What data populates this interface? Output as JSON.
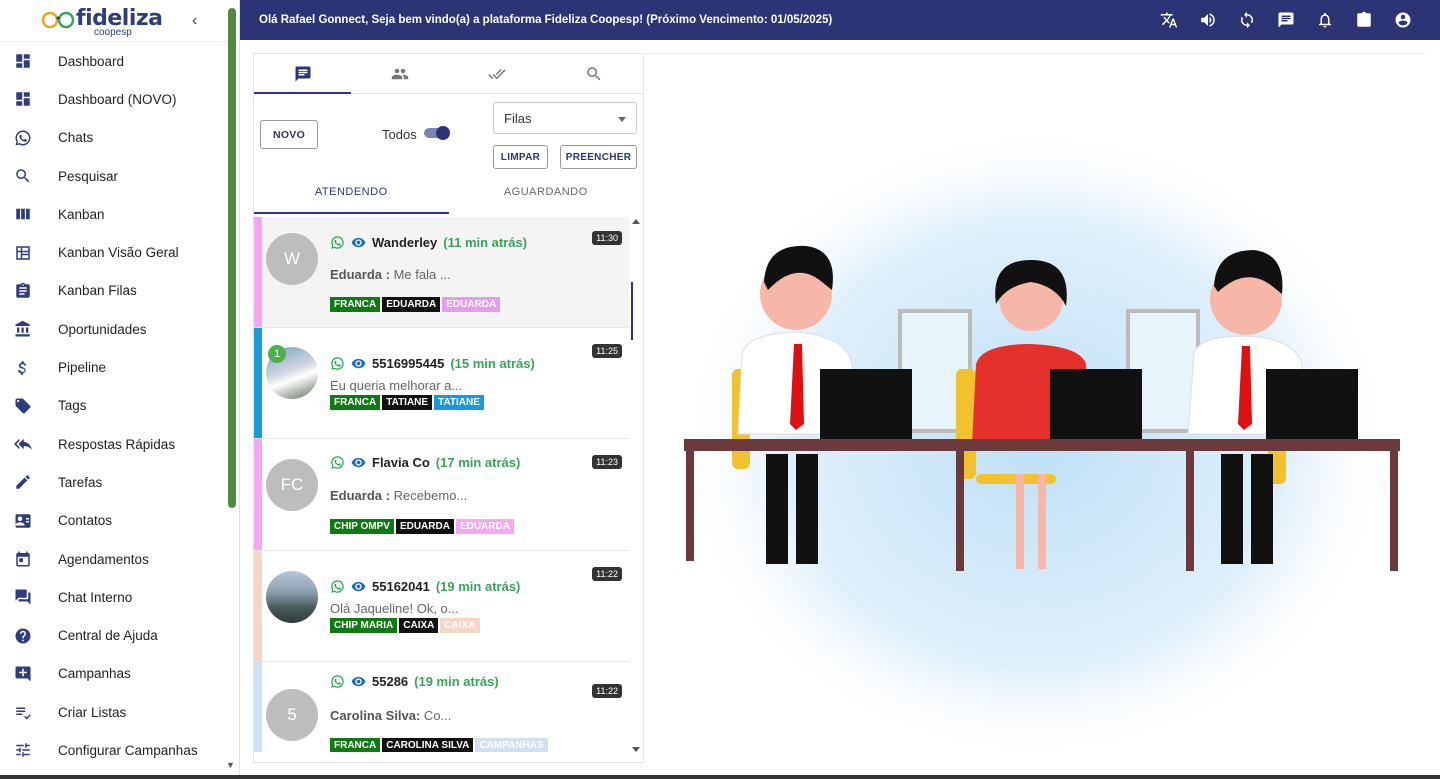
{
  "brand": {
    "name": "fideliza",
    "sub": "coopesp"
  },
  "topbar": {
    "welcome": "Olá Rafael Gonnect, Seja bem vindo(a) a plataforma Fideliza Coopesp! (Próximo Vencimento: 01/05/2025)",
    "icons": [
      "translate-icon",
      "volume-icon",
      "sync-icon",
      "message-icon",
      "notification-icon",
      "clipboard-icon",
      "account-icon"
    ]
  },
  "sidebar": {
    "items": [
      {
        "label": "Dashboard",
        "icon": "dashboard-icon"
      },
      {
        "label": "Dashboard (NOVO)",
        "icon": "dashboard-icon"
      },
      {
        "label": "Chats",
        "icon": "whatsapp-icon"
      },
      {
        "label": "Pesquisar",
        "icon": "search-icon"
      },
      {
        "label": "Kanban",
        "icon": "kanban-icon"
      },
      {
        "label": "Kanban Visão Geral",
        "icon": "grid-icon"
      },
      {
        "label": "Kanban Filas",
        "icon": "clipboard-icon"
      },
      {
        "label": "Oportunidades",
        "icon": "bank-icon"
      },
      {
        "label": "Pipeline",
        "icon": "dollar-icon"
      },
      {
        "label": "Tags",
        "icon": "tag-icon"
      },
      {
        "label": "Respostas Rápidas",
        "icon": "reply-all-icon"
      },
      {
        "label": "Tarefas",
        "icon": "pencil-icon"
      },
      {
        "label": "Contatos",
        "icon": "contacts-icon"
      },
      {
        "label": "Agendamentos",
        "icon": "calendar-icon"
      },
      {
        "label": "Chat Interno",
        "icon": "forum-icon"
      },
      {
        "label": "Central de Ajuda",
        "icon": "help-icon"
      },
      {
        "label": "Campanhas",
        "icon": "add-comment-icon"
      },
      {
        "label": "Criar Listas",
        "icon": "list-check-icon"
      },
      {
        "label": "Configurar Campanhas",
        "icon": "tune-icon"
      }
    ]
  },
  "panel": {
    "tabs": [
      "chat-icon",
      "people-icon",
      "done-all-icon",
      "search-icon"
    ],
    "novo": "NOVO",
    "todos": "Todos",
    "filas_placeholder": "Filas",
    "limpar": "LIMPAR",
    "preencher": "PREENCHER",
    "subtabs": [
      "ATENDENDO",
      "AGUARDANDO"
    ]
  },
  "chats": [
    {
      "avatar": "W",
      "name": "Wanderley",
      "ago": "(11 min atrás)",
      "time": "11:30",
      "sender": "Eduarda :",
      "text": " Me fala ...",
      "strip": "#f4a8f0",
      "tags": [
        {
          "label": "FRANCA",
          "color": "#0f7a12"
        },
        {
          "label": "EDUARDA",
          "color": "#111111"
        },
        {
          "label": "EDUARDA",
          "color": "#e79bf0"
        }
      ]
    },
    {
      "avatar": "",
      "badge": "1",
      "name": "5516995445",
      "ago": "(15 min atrás)",
      "time": "11:25",
      "sender": "",
      "text": "Eu queria melhorar a...",
      "strip": "#1a9ad6",
      "tags": [
        {
          "label": "FRANCA",
          "color": "#0f7a12"
        },
        {
          "label": "TATIANE",
          "color": "#111111"
        },
        {
          "label": "TATIANE",
          "color": "#1a9ad6"
        }
      ]
    },
    {
      "avatar": "FC",
      "name": "Flavia Co",
      "ago": "(17 min atrás)",
      "time": "11:23",
      "sender": "Eduarda :",
      "text": " Recebemo...",
      "strip": "#f4a8f0",
      "tags": [
        {
          "label": "CHIP OMPV",
          "color": "#0f7a12"
        },
        {
          "label": "EDUARDA",
          "color": "#111111"
        },
        {
          "label": "EDUARDA",
          "color": "#f4a8f0"
        }
      ]
    },
    {
      "avatar": "",
      "name": "55162041",
      "ago": "(19 min atrás)",
      "time": "11:22",
      "sender": "",
      "text": "Olá Jaqueline! Ok, o...",
      "strip": "#f8d6c7",
      "tags": [
        {
          "label": "CHIP MARIA",
          "color": "#0f7a12"
        },
        {
          "label": "CAIXA",
          "color": "#111111"
        },
        {
          "label": "CAIXA",
          "color": "#f8d6c7"
        }
      ]
    },
    {
      "avatar": "5",
      "name": "55286",
      "ago": "(19 min atrás)",
      "time": "11:22",
      "sender": "Carolina Silva:",
      "text": " Co...",
      "strip": "#cfe0f4",
      "tags": [
        {
          "label": "FRANCA",
          "color": "#0f7a12"
        },
        {
          "label": "CAROLINA SILVA",
          "color": "#111111"
        },
        {
          "label": "CAMPANHAS",
          "color": "#cfe0f4"
        }
      ]
    }
  ],
  "colors": {
    "accent": "#2d3475",
    "green": "#3aa35a",
    "whatsapp": "#1fa855"
  }
}
